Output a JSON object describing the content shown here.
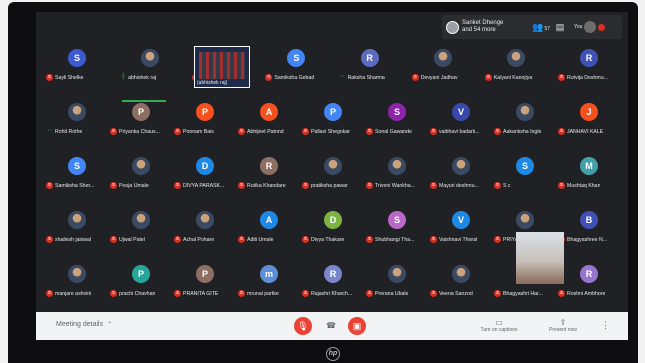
{
  "presence": {
    "line1": "Sanket Dhenge",
    "line2": "and 54 more",
    "people_count": "57",
    "you_label": "You"
  },
  "participants": [
    {
      "name": "Sayli Shelke",
      "avatar": "S",
      "color": "#3c5bd1",
      "mic": "muted"
    },
    {
      "name": "abhishek raj",
      "avatar": "",
      "color": "",
      "mic": "speaking"
    },
    {
      "name": "Rupali Solanke",
      "avatar": "",
      "color": "#202124",
      "mic": "muted"
    },
    {
      "name": "Samiksha Gebad",
      "avatar": "S",
      "color": "#4285f4",
      "mic": "muted"
    },
    {
      "name": "Raksha Sharma",
      "avatar": "R",
      "color": "#5c6bc0",
      "mic": "talking"
    },
    {
      "name": "Devyani Jadhav",
      "avatar": "",
      "color": "",
      "mic": "muted"
    },
    {
      "name": "Kalyani Kanojiya",
      "avatar": "",
      "color": "",
      "mic": "muted"
    },
    {
      "name": "Rutvija Deshmu...",
      "avatar": "R",
      "color": "#3f51b5",
      "mic": "muted"
    },
    {
      "name": "Rohit Rothe",
      "avatar": "",
      "color": "#b8860b",
      "mic": "talking"
    },
    {
      "name": "Priyanka Chaux...",
      "avatar": "P",
      "color": "#8d6e63",
      "mic": "muted"
    },
    {
      "name": "Poonam Bais",
      "avatar": "P",
      "color": "#f4511e",
      "mic": "muted"
    },
    {
      "name": "Abhijeet Patond",
      "avatar": "A",
      "color": "#f4511e",
      "mic": "muted"
    },
    {
      "name": "Pallavi Shegokar",
      "avatar": "P",
      "color": "#4285f4",
      "mic": "muted"
    },
    {
      "name": "Sonal Gawande",
      "avatar": "S",
      "color": "#8e24aa",
      "mic": "muted"
    },
    {
      "name": "vaibhavi badark...",
      "avatar": "V",
      "color": "#3949ab",
      "mic": "muted"
    },
    {
      "name": "Aakanksha Ingle",
      "avatar": "",
      "color": "",
      "mic": "muted"
    },
    {
      "name": "JANHAVI KALE",
      "avatar": "J",
      "color": "#f4511e",
      "mic": "muted"
    },
    {
      "name": "Samiksha Sher...",
      "avatar": "S",
      "color": "#4285f4",
      "mic": "muted"
    },
    {
      "name": "Pooja Umale",
      "avatar": "",
      "color": "",
      "mic": "muted"
    },
    {
      "name": "DIVYA PARASK...",
      "avatar": "D",
      "color": "#1e88e5",
      "mic": "muted"
    },
    {
      "name": "Rutika Khandare",
      "avatar": "R",
      "color": "#8d6e63",
      "mic": "muted"
    },
    {
      "name": "pratiksha pawar",
      "avatar": "",
      "color": "",
      "mic": "muted"
    },
    {
      "name": "Triveni Wankha...",
      "avatar": "",
      "color": "",
      "mic": "muted"
    },
    {
      "name": "Mayuri deshmu...",
      "avatar": "",
      "color": "",
      "mic": "muted"
    },
    {
      "name": "S c",
      "avatar": "S",
      "color": "#1e88e5",
      "mic": "muted"
    },
    {
      "name": "Mushtaq Khan",
      "avatar": "M",
      "color": "#43a0a8",
      "mic": "muted"
    },
    {
      "name": "shailesh jaiswal",
      "avatar": "",
      "color": "",
      "mic": "muted"
    },
    {
      "name": "Ujwal Patel",
      "avatar": "",
      "color": "",
      "mic": "muted"
    },
    {
      "name": "Achal Pohare",
      "avatar": "",
      "color": "",
      "mic": "muted"
    },
    {
      "name": "Aditi Umale",
      "avatar": "A",
      "color": "#1e88e5",
      "mic": "muted"
    },
    {
      "name": "Divya Thakare",
      "avatar": "D",
      "color": "#7cb342",
      "mic": "muted"
    },
    {
      "name": "Shubhangi Tha...",
      "avatar": "S",
      "color": "#ba68c8",
      "mic": "muted"
    },
    {
      "name": "Vaishnavi Thorat",
      "avatar": "V",
      "color": "#1e88e5",
      "mic": "muted"
    },
    {
      "name": "PRIYANKA SHA...",
      "avatar": "",
      "color": "",
      "mic": "muted"
    },
    {
      "name": "Bhagyashree N...",
      "avatar": "B",
      "color": "#3f51b5",
      "mic": "muted"
    },
    {
      "name": "manjare ashvini",
      "avatar": "",
      "color": "",
      "mic": "muted"
    },
    {
      "name": "prachi Chavhan",
      "avatar": "P",
      "color": "#26a69a",
      "mic": "muted"
    },
    {
      "name": "PRANITA GITE",
      "avatar": "P",
      "color": "#8d6e63",
      "mic": "muted"
    },
    {
      "name": "mrunal partke",
      "avatar": "m",
      "color": "#5c8fd6",
      "mic": "muted"
    },
    {
      "name": "Rajashri Kharch...",
      "avatar": "R",
      "color": "#7986cb",
      "mic": "muted"
    },
    {
      "name": "Prerana Ubale",
      "avatar": "",
      "color": "",
      "mic": "muted"
    },
    {
      "name": "Veena Sanzod",
      "avatar": "",
      "color": "",
      "mic": "muted"
    },
    {
      "name": "Bhagyashri Har...",
      "avatar": "B",
      "color": "#8d6e63",
      "mic": "muted"
    },
    {
      "name": "Roshni Ambhore",
      "avatar": "R",
      "color": "#9575cd",
      "mic": "muted"
    }
  ],
  "screenshare_name": "(abhishek raj)",
  "bottom": {
    "meeting_details": "Meeting details",
    "turn_on_captions": "Turn on captions",
    "present_now": "Present now"
  }
}
